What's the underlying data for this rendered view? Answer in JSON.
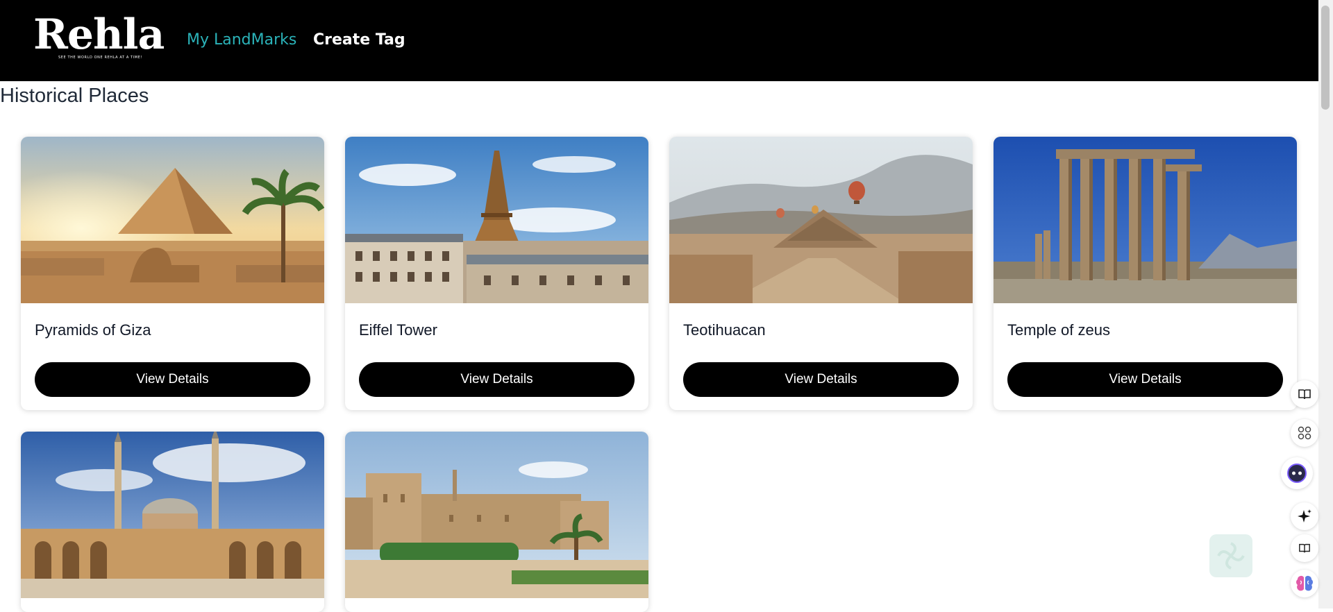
{
  "app": {
    "logo_text": "Rehla",
    "tagline": "SEE THE WORLD ONE REHLA AT A TIME!"
  },
  "nav": {
    "items": [
      {
        "label": "My LandMarks",
        "active": true
      },
      {
        "label": "Create Tag",
        "active": false
      }
    ],
    "active_color": "#2bb3b9"
  },
  "main": {
    "title": "Historical Places",
    "button_label": "View Details",
    "cards": [
      {
        "name": "Pyramids of Giza",
        "image": "pyramids-sphinx-scene"
      },
      {
        "name": "Eiffel Tower",
        "image": "eiffel-tower-paris-scene"
      },
      {
        "name": "Teotihuacan",
        "image": "teotihuacan-balloons-scene"
      },
      {
        "name": "Temple of zeus",
        "image": "temple-of-zeus-columns-scene"
      },
      {
        "name": "",
        "image": "mosque-courtyard-minarets-scene"
      },
      {
        "name": "",
        "image": "citadel-fortress-scene"
      }
    ]
  },
  "side_tools": [
    {
      "icon": "book-icon"
    },
    {
      "icon": "apps-grid-icon"
    },
    {
      "icon": "assistant-face-icon"
    },
    {
      "icon": "sparkle-icon"
    },
    {
      "icon": "open-book-icon"
    },
    {
      "icon": "brain-icon"
    }
  ],
  "colors": {
    "header_bg": "#000000",
    "button_bg": "#000000",
    "button_text": "#ffffff",
    "title_text": "#1f2937"
  }
}
